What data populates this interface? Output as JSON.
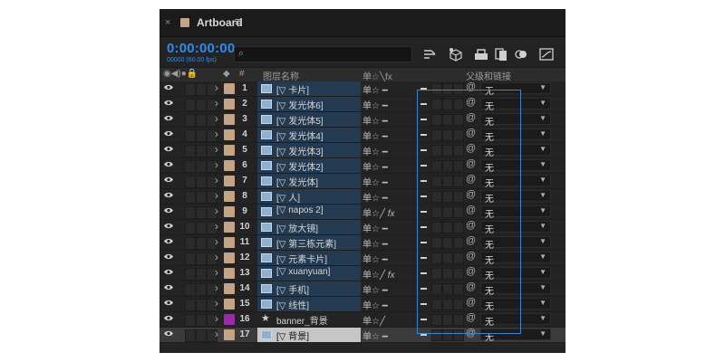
{
  "panel": {
    "tab": {
      "close": "×",
      "title": "Artboard",
      "menu": "≡"
    },
    "timecode": {
      "main": "0:00:00:00",
      "sub": "00000 (60.00 fps)"
    },
    "search": {
      "icon": "search-icon",
      "value": ""
    },
    "toolbar": [
      "composition-mini-flowchart-icon",
      "draft-3d-icon",
      "shy-layers-icon",
      "frame-blending-icon",
      "motion-blur-icon",
      "graph-editor-icon"
    ],
    "headers": {
      "num": "#",
      "layer_name": "图层名称",
      "switches": "单☆╲fx",
      "parent": "父级和链接"
    },
    "rows": [
      {
        "num": "1",
        "name": "[▽ 卡片]",
        "type": "comp",
        "label": "#c4a484",
        "fx": false,
        "cont": false
      },
      {
        "num": "2",
        "name": "[▽ 发光体6]",
        "type": "comp",
        "label": "#c4a484",
        "fx": false,
        "cont": false
      },
      {
        "num": "3",
        "name": "[▽ 发光体5]",
        "type": "comp",
        "label": "#c4a484",
        "fx": false,
        "cont": false
      },
      {
        "num": "4",
        "name": "[▽ 发光体4]",
        "type": "comp",
        "label": "#c4a484",
        "fx": false,
        "cont": false
      },
      {
        "num": "5",
        "name": "[▽ 发光体3]",
        "type": "comp",
        "label": "#c4a484",
        "fx": false,
        "cont": false
      },
      {
        "num": "6",
        "name": "[▽ 发光体2]",
        "type": "comp",
        "label": "#c4a484",
        "fx": false,
        "cont": false
      },
      {
        "num": "7",
        "name": "[▽ 发光体]",
        "type": "comp",
        "label": "#c4a484",
        "fx": false,
        "cont": false
      },
      {
        "num": "8",
        "name": "[▽ 人]",
        "type": "comp",
        "label": "#c4a484",
        "fx": false,
        "cont": false
      },
      {
        "num": "9",
        "name": "[▽ napos 2]",
        "type": "comp",
        "label": "#c4a484",
        "fx": true,
        "cont": true
      },
      {
        "num": "10",
        "name": "[▽ 放大镜]",
        "type": "comp",
        "label": "#c4a484",
        "fx": false,
        "cont": false
      },
      {
        "num": "11",
        "name": "[▽ 第三栋元素]",
        "type": "comp",
        "label": "#c4a484",
        "fx": false,
        "cont": false
      },
      {
        "num": "12",
        "name": "[▽ 元素卡片]",
        "type": "comp",
        "label": "#c4a484",
        "fx": false,
        "cont": false
      },
      {
        "num": "13",
        "name": "[▽ xuanyuan]",
        "type": "comp",
        "label": "#c4a484",
        "fx": true,
        "cont": true
      },
      {
        "num": "14",
        "name": "[▽ 手机]",
        "type": "comp",
        "label": "#c4a484",
        "fx": false,
        "cont": false
      },
      {
        "num": "15",
        "name": "[▽ 线性]",
        "type": "comp",
        "label": "#c4a484",
        "fx": false,
        "cont": false
      },
      {
        "num": "16",
        "name": "banner_背景",
        "type": "shape",
        "label": "#9a2aa8",
        "fx": false,
        "cont": true
      },
      {
        "num": "17",
        "name": "[▽ 背景]",
        "type": "comp",
        "label": "#c4a484",
        "fx": false,
        "cont": false
      }
    ],
    "parent_value": "无",
    "colors": {
      "accent": "#2d8ceb",
      "selection": "#233a50",
      "selection_border": "#3b84c8"
    }
  }
}
